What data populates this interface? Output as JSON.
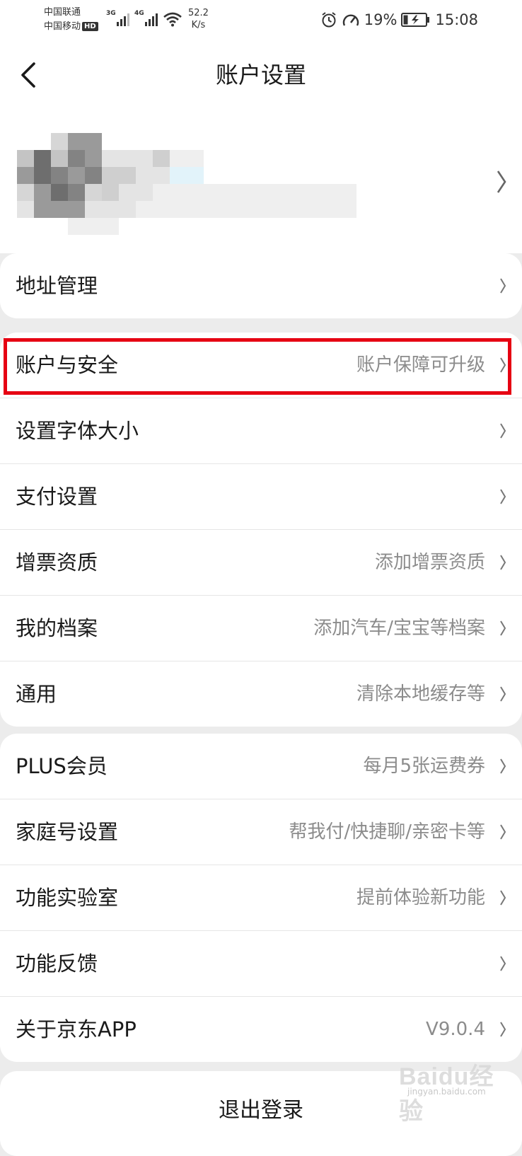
{
  "status_bar": {
    "carrier1": "中国联通",
    "carrier2": "中国移动",
    "hd_badge": "HD",
    "sig1_type": "3G",
    "sig2_type": "4G",
    "speed_value": "52.2",
    "speed_unit": "K/s",
    "battery": "19%",
    "time": "15:08"
  },
  "header": {
    "title": "账户设置"
  },
  "groups": [
    {
      "items": [
        {
          "label": "地址管理",
          "value": ""
        }
      ]
    },
    {
      "items": [
        {
          "label": "账户与安全",
          "value": "账户保障可升级"
        },
        {
          "label": "设置字体大小",
          "value": ""
        },
        {
          "label": "支付设置",
          "value": ""
        },
        {
          "label": "增票资质",
          "value": "添加增票资质"
        },
        {
          "label": "我的档案",
          "value": "添加汽车/宝宝等档案"
        },
        {
          "label": "通用",
          "value": "清除本地缓存等"
        }
      ]
    },
    {
      "items": [
        {
          "label": "PLUS会员",
          "value": "每月5张运费券"
        },
        {
          "label": "家庭号设置",
          "value": "帮我付/快捷聊/亲密卡等"
        },
        {
          "label": "功能实验室",
          "value": "提前体验新功能"
        },
        {
          "label": "功能反馈",
          "value": ""
        },
        {
          "label": "关于京东APP",
          "value": "V9.0.4"
        }
      ]
    }
  ],
  "logout_label": "退出登录",
  "watermark": {
    "brand": "Baidu经验",
    "url": "jingyan.baidu.com"
  },
  "colors": {
    "highlight": "#e60012",
    "background": "#ececec",
    "secondary_text": "#8c8c8c"
  },
  "icons": [
    "back-arrow-icon",
    "chevron-right-icon",
    "alarm-icon",
    "speedometer-icon",
    "battery-charging-icon",
    "wifi-icon",
    "signal-icon"
  ]
}
